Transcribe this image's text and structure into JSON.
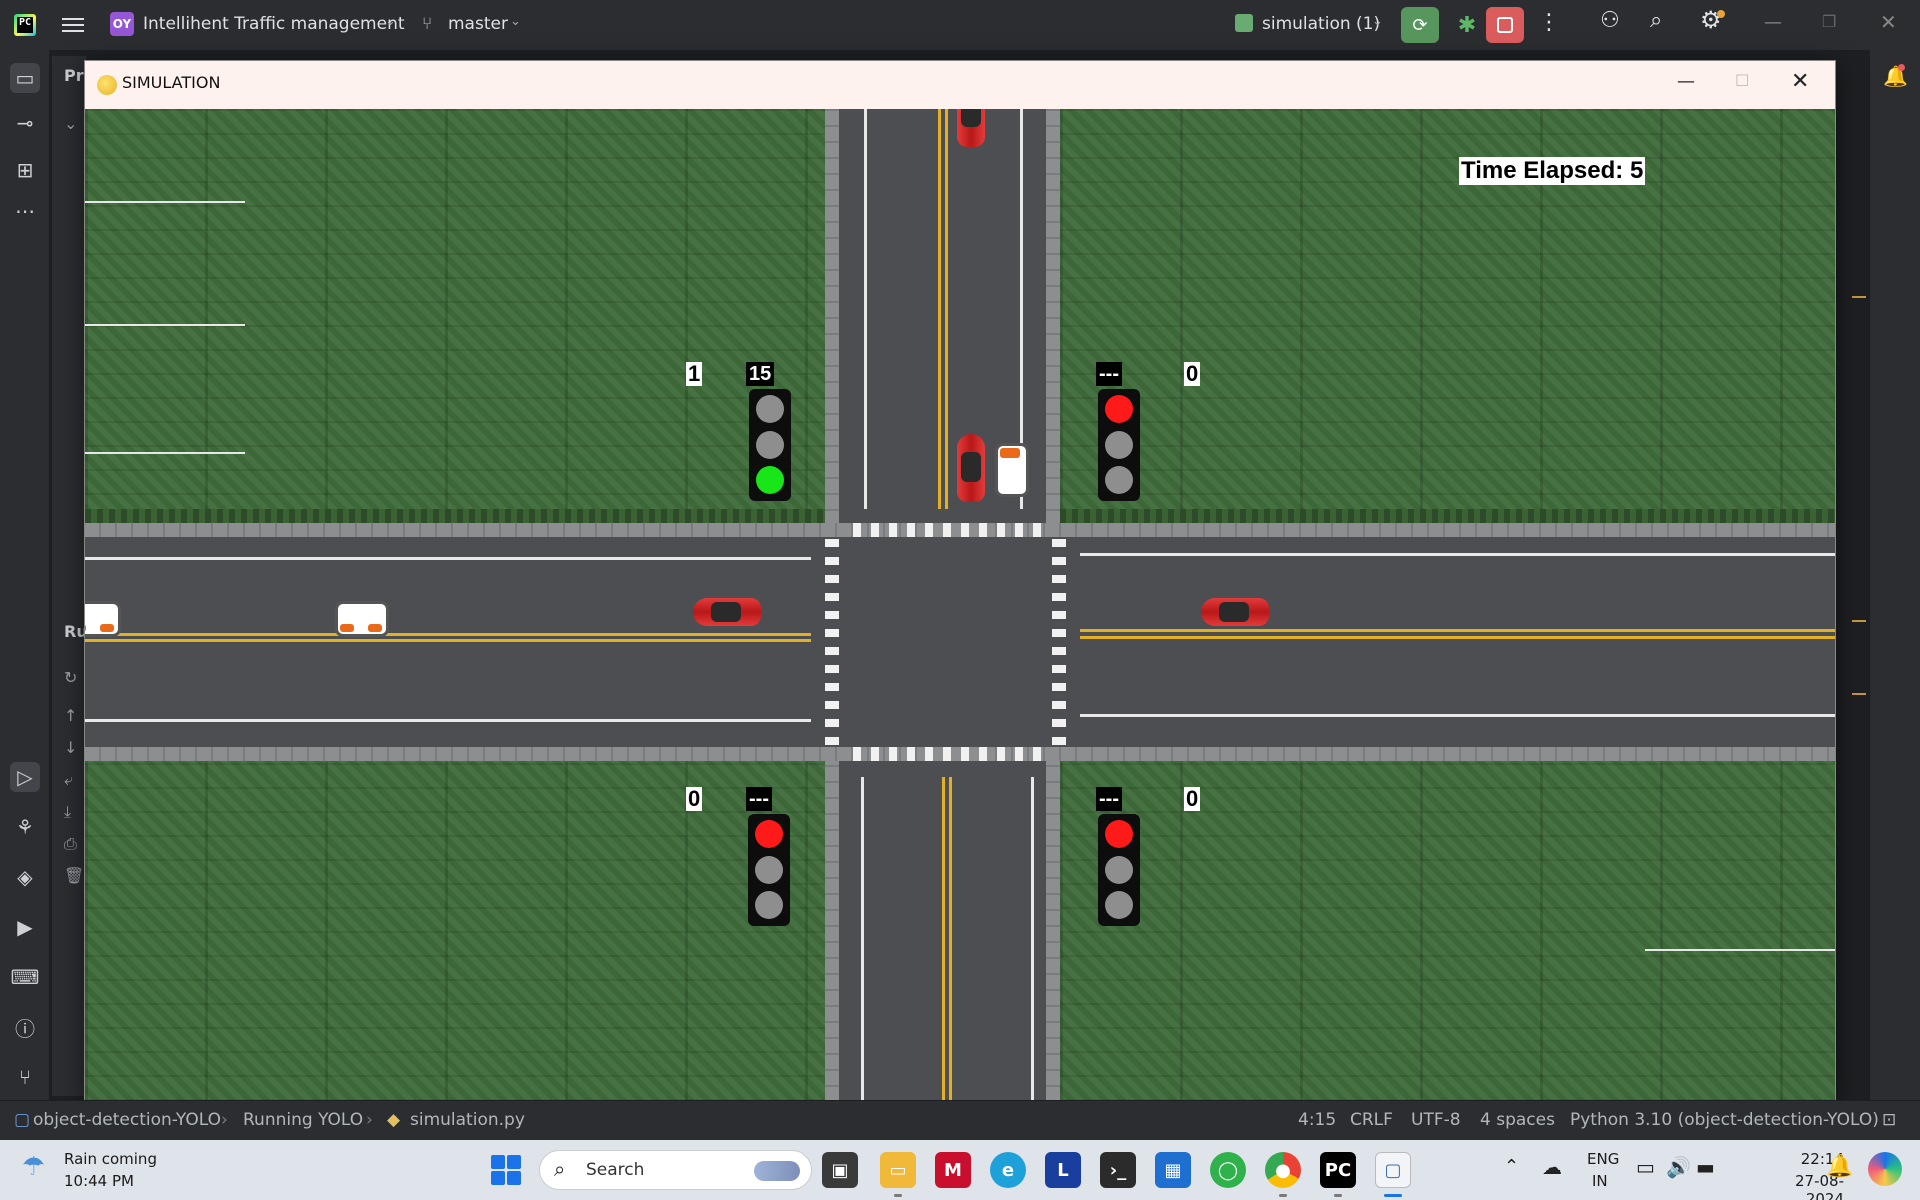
{
  "ide": {
    "logo_text": "PC",
    "project_badge": "OY",
    "project_name": "Intellihent Traffic management",
    "branch": "master",
    "run_config": "simulation (1)",
    "left_panel_partial_1": "Pr",
    "left_panel_partial_2": "Ru"
  },
  "sim_window": {
    "title": "SIMULATION",
    "time_elapsed": "Time Elapsed: 5",
    "signals": [
      {
        "id": "north-west",
        "timer": "15",
        "count": "1",
        "state": "green"
      },
      {
        "id": "north-east",
        "timer": "---",
        "count": "0",
        "state": "red"
      },
      {
        "id": "south-west",
        "timer": "---",
        "count": "0",
        "state": "red"
      },
      {
        "id": "south-east",
        "timer": "---",
        "count": "0",
        "state": "red"
      }
    ],
    "colors": {
      "grass": "#3f6b3a",
      "road": "#4d4e51",
      "lane_yellow": "#e2b023",
      "signal_red": "#ff1a1a",
      "signal_green": "#19e619"
    }
  },
  "status_bar": {
    "project": "object-detection-YOLO",
    "run": "Running YOLO",
    "file": "simulation.py",
    "position": "4:15",
    "line_ending": "CRLF",
    "encoding": "UTF-8",
    "indent": "4 spaces",
    "interpreter": "Python 3.10 (object-detection-YOLO)"
  },
  "taskbar": {
    "weather_title": "Rain coming",
    "weather_time": "10:44 PM",
    "search_placeholder": "Search",
    "lang_line1": "ENG",
    "lang_line2": "IN",
    "clock_time": "22:14",
    "clock_date": "27-08-2024"
  }
}
